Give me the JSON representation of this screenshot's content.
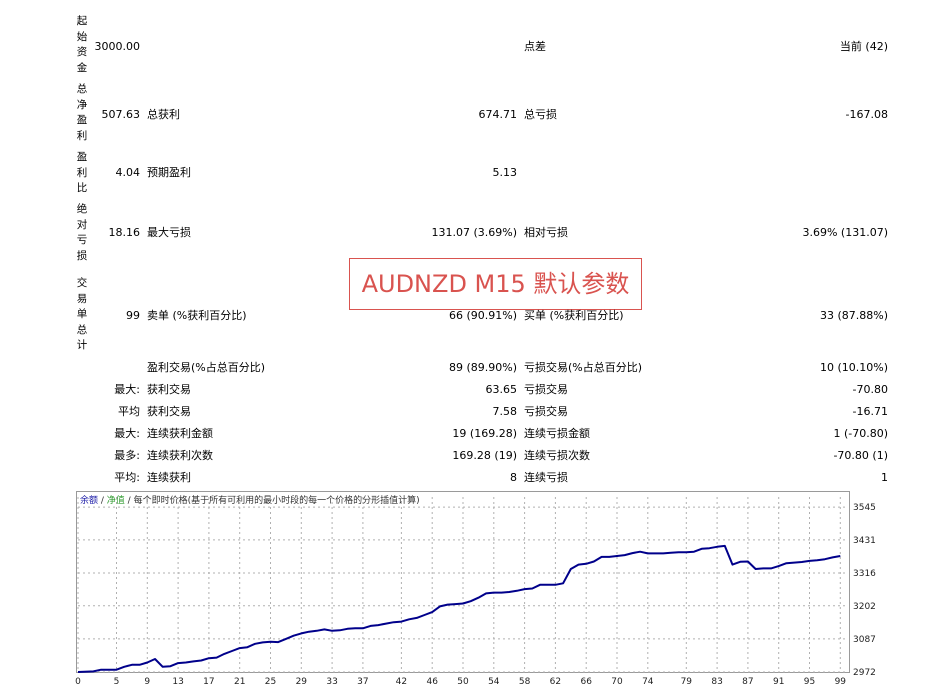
{
  "report": {
    "row_initial": {
      "vlabel": "起始资金",
      "value": "3000.00",
      "mid_label": "点差",
      "right_value": "当前 (42)"
    },
    "row_net": {
      "vlabel": "总净盈利",
      "value": "507.63",
      "label1": "总获利",
      "value1": "674.71",
      "label2": "总亏损",
      "value2": "-167.08"
    },
    "row_pf": {
      "vlabel": "盈利比",
      "value": "4.04",
      "label1": "预期盈利",
      "value1": "5.13"
    },
    "row_abs": {
      "vlabel": "绝对亏损",
      "value": "18.16",
      "label1": "最大亏损",
      "value1": "131.07 (3.69%)",
      "label2": "相对亏损",
      "value2": "3.69% (131.07)"
    },
    "row_trades": {
      "vlabel": "交易单总计",
      "value": "99",
      "label1": "卖单 (%获利百分比)",
      "value1": "66 (90.91%)",
      "label2": "买单 (%获利百分比)",
      "value2": "33 (87.88%)"
    },
    "row_win": {
      "label1": "盈利交易(%占总百分比)",
      "value1": "89 (89.90%)",
      "label2": "亏损交易(%占总百分比)",
      "value2": "10 (10.10%)"
    },
    "row_max": {
      "prefix": "最大:",
      "label1": "获利交易",
      "value1": "63.65",
      "label2": "亏损交易",
      "value2": "-70.80"
    },
    "row_avg": {
      "prefix": "平均",
      "label1": "获利交易",
      "value1": "7.58",
      "label2": "亏损交易",
      "value2": "-16.71"
    },
    "row_maxcons": {
      "prefix": "最大:",
      "label1": "连续获利金额",
      "value1": "19 (169.28)",
      "label2": "连续亏损金额",
      "value2": "1 (-70.80)"
    },
    "row_mostcons": {
      "prefix": "最多:",
      "label1": "连续获利次数",
      "value1": "169.28 (19)",
      "label2": "连续亏损次数",
      "value2": "-70.80 (1)"
    },
    "row_avgcons": {
      "prefix": "平均:",
      "label1": "连续获利",
      "value1": "8",
      "label2": "连续亏损",
      "value2": "1"
    }
  },
  "banner": {
    "text": "AUDNZD  M15 默认参数",
    "color": "#d9534f"
  },
  "legend": {
    "balance": "余额",
    "sep1": " / ",
    "equity": "净值",
    "sep2": " / ",
    "description": "每个即时价格(基于所有可利用的最小时段的每一个价格的分形插值计算)"
  },
  "colors": {
    "balance_line": "#00008b",
    "grid": "#b0b0b0"
  },
  "chart_data": {
    "type": "line",
    "title": "",
    "xlabel": "",
    "ylabel": "",
    "x_ticks": [
      0,
      5,
      9,
      13,
      17,
      21,
      25,
      29,
      33,
      37,
      42,
      46,
      50,
      54,
      58,
      62,
      66,
      70,
      74,
      79,
      83,
      87,
      91,
      95,
      99
    ],
    "y_ticks": [
      2972,
      3087,
      3202,
      3316,
      3431,
      3545
    ],
    "xlim": [
      0,
      100
    ],
    "ylim": [
      2972,
      3580
    ],
    "grid": true,
    "series": [
      {
        "name": "余额",
        "x": [
          0,
          2,
          3,
          5,
          6,
          7,
          8,
          9,
          10,
          11,
          12,
          13,
          14,
          15,
          16,
          17,
          18,
          19,
          20,
          21,
          22,
          23,
          24,
          25,
          26,
          27,
          28,
          29,
          30,
          31,
          32,
          33,
          34,
          35,
          36,
          37,
          38,
          39,
          40,
          41,
          42,
          43,
          44,
          45,
          46,
          47,
          48,
          49,
          50,
          51,
          52,
          53,
          54,
          55,
          56,
          57,
          58,
          59,
          60,
          61,
          62,
          63,
          64,
          65,
          66,
          67,
          68,
          69,
          70,
          71,
          72,
          73,
          74,
          75,
          76,
          77,
          78,
          79,
          80,
          81,
          82,
          83,
          84,
          85,
          86,
          87,
          88,
          89,
          90,
          91,
          92,
          93,
          94,
          95,
          96,
          97,
          98,
          99
        ],
        "y": [
          2972,
          2974,
          2980,
          2980,
          2990,
          2997,
          2997,
          3005,
          3017,
          2990,
          2992,
          3003,
          3005,
          3009,
          3012,
          3020,
          3022,
          3035,
          3045,
          3055,
          3058,
          3070,
          3075,
          3077,
          3076,
          3087,
          3098,
          3106,
          3112,
          3115,
          3120,
          3115,
          3117,
          3122,
          3124,
          3124,
          3132,
          3135,
          3140,
          3145,
          3147,
          3155,
          3160,
          3170,
          3180,
          3200,
          3206,
          3208,
          3210,
          3218,
          3230,
          3245,
          3248,
          3248,
          3250,
          3254,
          3260,
          3262,
          3275,
          3275,
          3275,
          3280,
          3330,
          3345,
          3348,
          3356,
          3372,
          3372,
          3375,
          3378,
          3385,
          3390,
          3384,
          3384,
          3384,
          3386,
          3388,
          3388,
          3390,
          3400,
          3402,
          3407,
          3410,
          3345,
          3355,
          3356,
          3330,
          3332,
          3332,
          3340,
          3350,
          3352,
          3354,
          3358,
          3360,
          3364,
          3370,
          3375
        ]
      }
    ]
  }
}
